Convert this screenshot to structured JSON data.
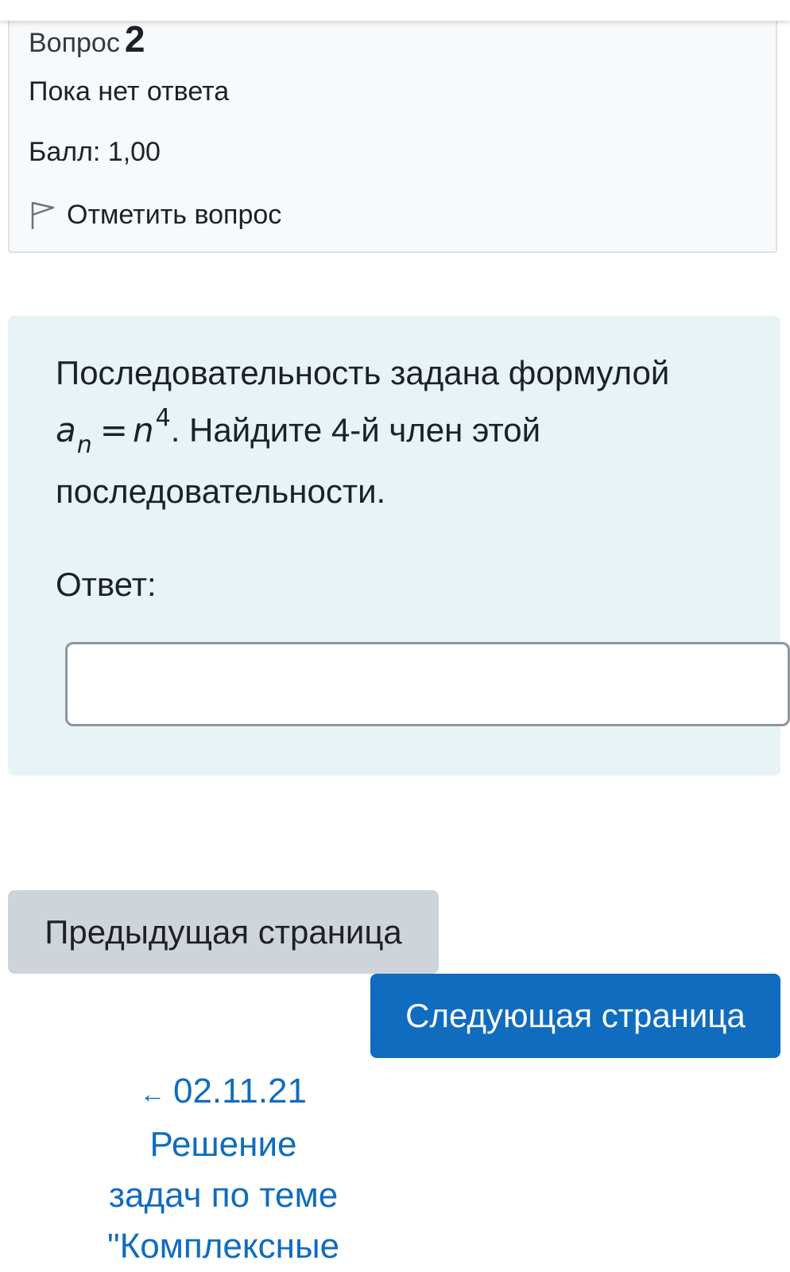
{
  "info": {
    "question_label": "Вопрос",
    "question_number": "2",
    "state": "Пока нет ответа",
    "grade": "Балл: 1,00",
    "flag_label": "Отметить вопрос",
    "flag_icon": "flag-icon"
  },
  "question": {
    "text_intro": "Последовательность задана формулой",
    "formula_var": "a",
    "formula_sub": "n",
    "formula_eq": "=",
    "formula_base": "n",
    "formula_exp": "4",
    "text_rest": ". Найдите 4-й член этой последовательности.",
    "answer_label": "Ответ:",
    "answer_value": ""
  },
  "navigation": {
    "prev_label": "Предыдущая страница",
    "next_label": "Следующая страница",
    "link_arrow": "←",
    "link_lines": [
      "02.11.21",
      "Решение",
      "задач по теме",
      "\"Комплексные"
    ]
  },
  "colors": {
    "question_bg": "#e7f3f5",
    "info_bg": "#f8f9fa",
    "primary": "#0f6cbf",
    "secondary": "#ced4da"
  }
}
